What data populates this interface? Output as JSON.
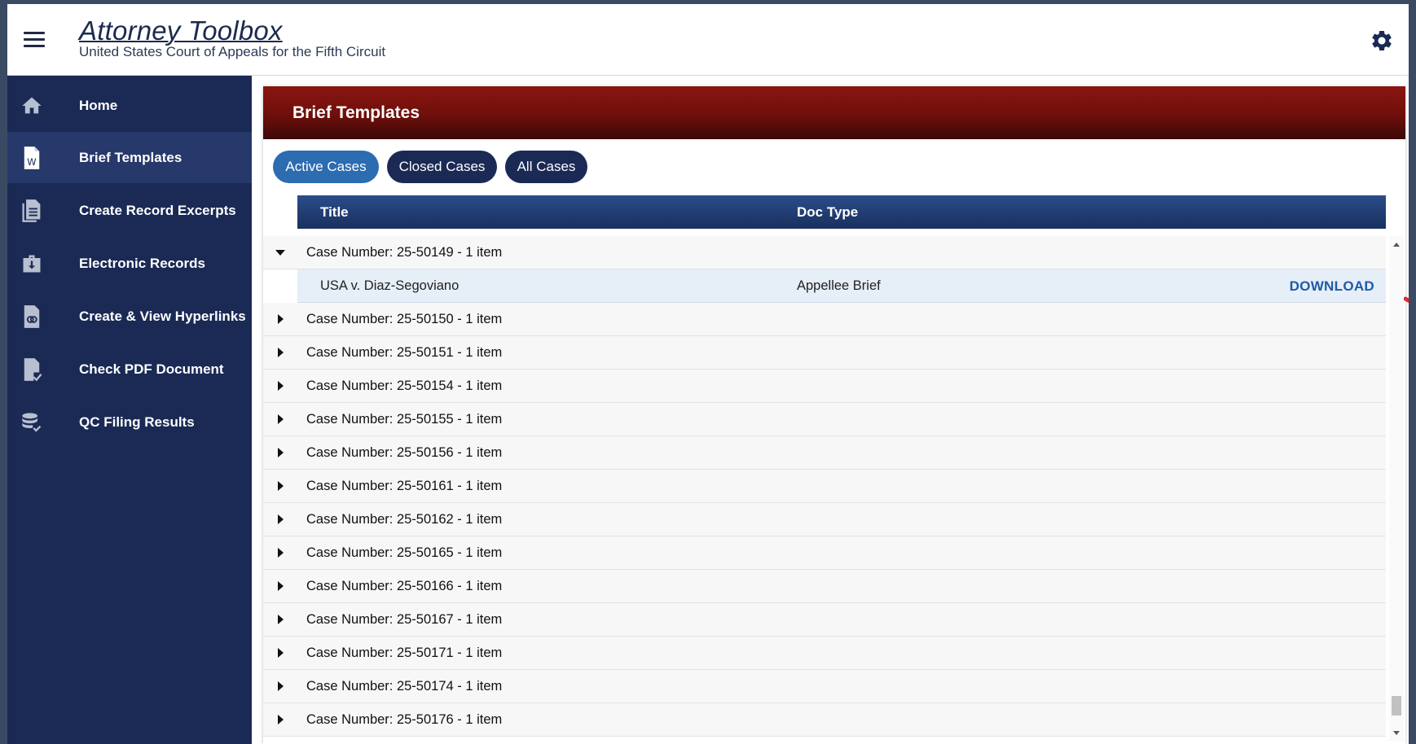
{
  "header": {
    "title": "Attorney Toolbox",
    "subtitle": "United States Court of Appeals for the Fifth Circuit"
  },
  "sidebar": {
    "items": [
      {
        "label": "Home",
        "icon": "home-icon"
      },
      {
        "label": "Brief Templates",
        "icon": "word-document-icon",
        "active": true
      },
      {
        "label": "Create Record Excerpts",
        "icon": "document-stack-icon"
      },
      {
        "label": "Electronic Records",
        "icon": "briefcase-download-icon"
      },
      {
        "label": "Create & View Hyperlinks",
        "icon": "link-document-icon"
      },
      {
        "label": "Check PDF Document",
        "icon": "document-check-icon"
      },
      {
        "label": "QC Filing Results",
        "icon": "database-check-icon"
      }
    ]
  },
  "main": {
    "title": "Brief Templates",
    "filters": [
      {
        "label": "Active Cases",
        "selected": true
      },
      {
        "label": "Closed Cases",
        "selected": false
      },
      {
        "label": "All Cases",
        "selected": false
      }
    ],
    "columns": {
      "title": "Title",
      "doc_type": "Doc Type"
    },
    "groups": [
      {
        "label": "Case Number: 25-50149 - 1 item",
        "expanded": true
      },
      {
        "label": "Case Number: 25-50150 - 1 item",
        "expanded": false
      },
      {
        "label": "Case Number: 25-50151 - 1 item",
        "expanded": false
      },
      {
        "label": "Case Number: 25-50154 - 1 item",
        "expanded": false
      },
      {
        "label": "Case Number: 25-50155 - 1 item",
        "expanded": false
      },
      {
        "label": "Case Number: 25-50156 - 1 item",
        "expanded": false
      },
      {
        "label": "Case Number: 25-50161 - 1 item",
        "expanded": false
      },
      {
        "label": "Case Number: 25-50162 - 1 item",
        "expanded": false
      },
      {
        "label": "Case Number: 25-50165 - 1 item",
        "expanded": false
      },
      {
        "label": "Case Number: 25-50166 - 1 item",
        "expanded": false
      },
      {
        "label": "Case Number: 25-50167 - 1 item",
        "expanded": false
      },
      {
        "label": "Case Number: 25-50171 - 1 item",
        "expanded": false
      },
      {
        "label": "Case Number: 25-50174 - 1 item",
        "expanded": false
      },
      {
        "label": "Case Number: 25-50176 - 1 item",
        "expanded": false
      }
    ],
    "expanded_item": {
      "title": "USA v. Diaz-Segoviano",
      "doc_type": "Appellee Brief",
      "action": "DOWNLOAD"
    }
  },
  "colors": {
    "sidebar_bg": "#1a2a55",
    "header_red": "#7a120d",
    "accent_blue": "#2c6cb0",
    "download_blue": "#1e5aa8",
    "annotation_red": "#e8292b"
  }
}
